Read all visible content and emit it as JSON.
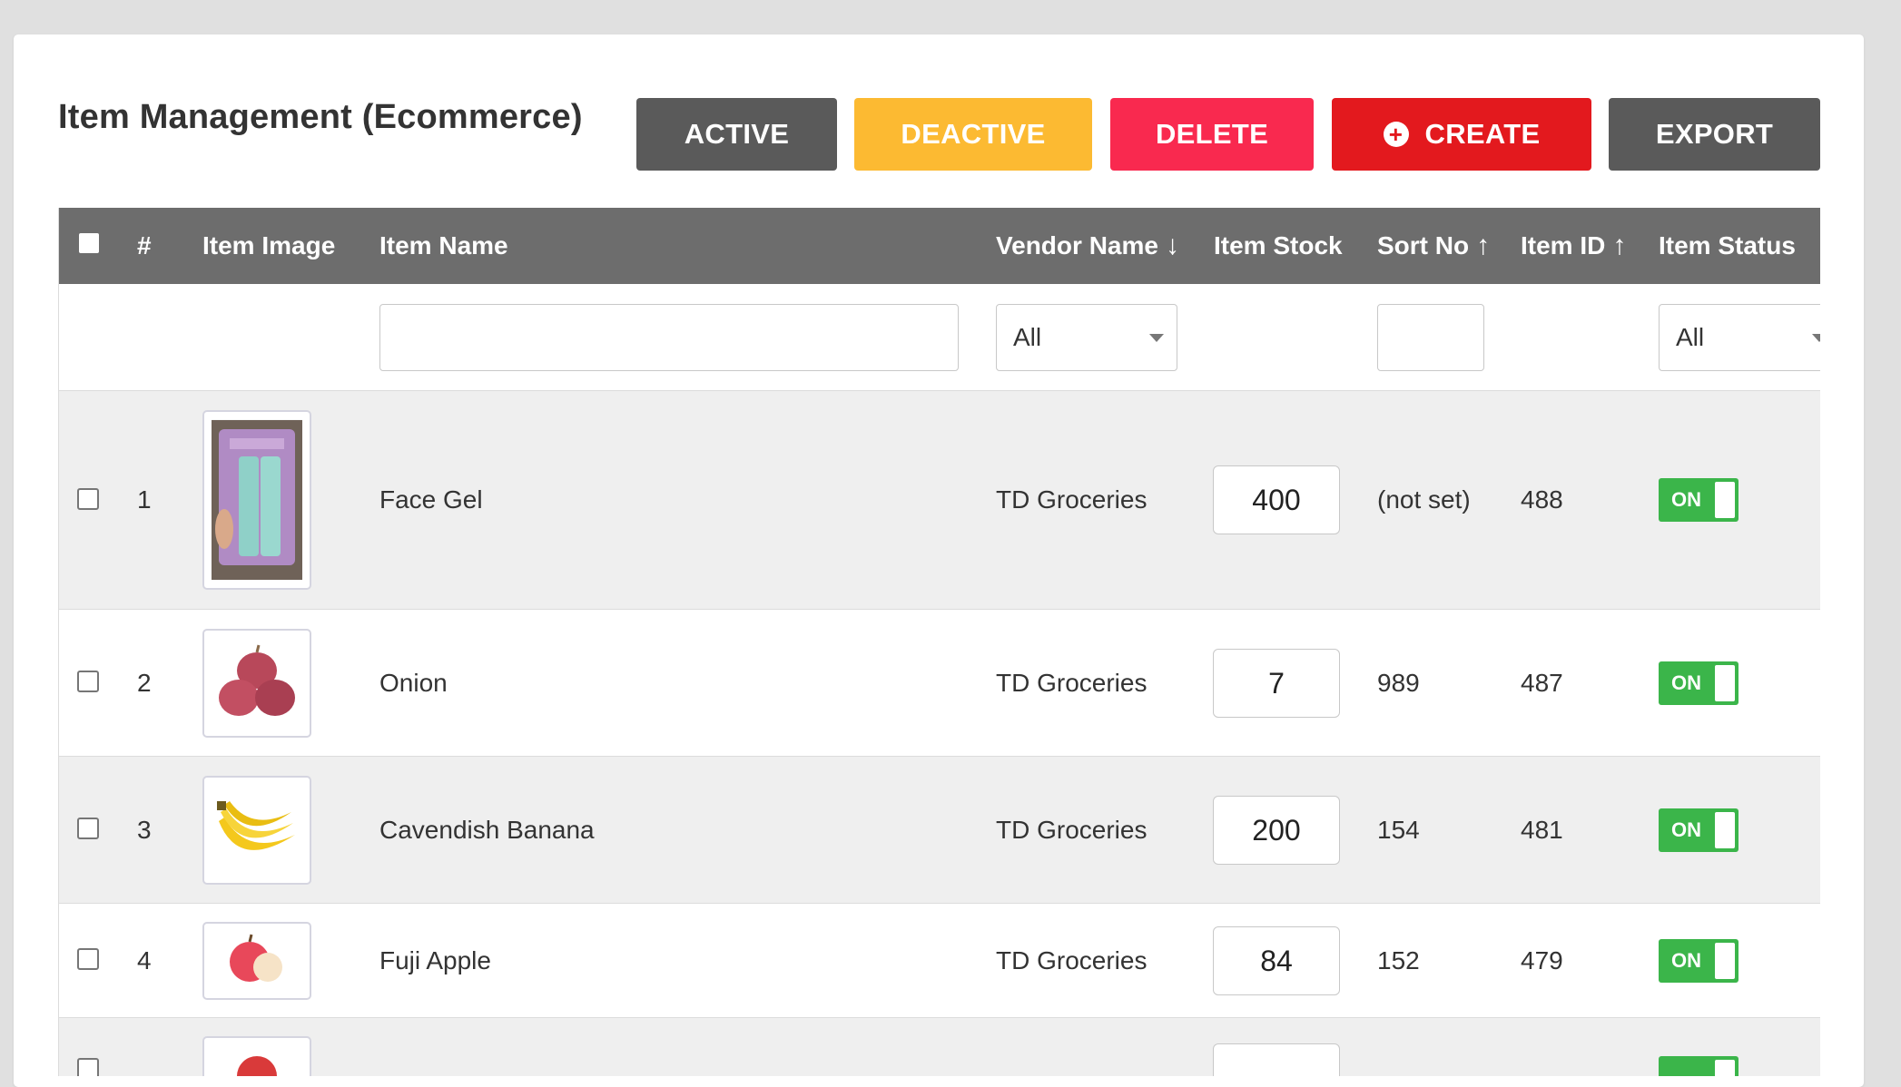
{
  "header": {
    "title": "Item Management (Ecommerce)",
    "buttons": {
      "active": "ACTIVE",
      "deactive": "DEACTIVE",
      "delete": "DELETE",
      "create": "CREATE",
      "export": "EXPORT"
    }
  },
  "colors": {
    "active_btn": "#5a5a5a",
    "deactive_btn": "#fcba32",
    "delete_btn": "#f9294f",
    "create_btn": "#e3191e",
    "export_btn": "#5a5a5a",
    "table_header": "#6d6d6d",
    "toggle_on": "#3bb54a"
  },
  "table": {
    "columns": {
      "num": "#",
      "image": "Item Image",
      "name": "Item Name",
      "vendor": "Vendor Name",
      "stock": "Item Stock",
      "sort": "Sort No",
      "id": "Item ID",
      "status": "Item Status"
    },
    "sort_icons": {
      "vendor": "arrow-down-icon",
      "sort": "arrow-up-icon",
      "id": "arrow-up-icon"
    },
    "filters": {
      "name_value": "",
      "vendor_selected": "All",
      "sort_value": "",
      "status_selected": "All"
    },
    "rows": [
      {
        "num": "1",
        "image_icon": "travel-bottles-image",
        "name": "Face Gel",
        "vendor": "TD Groceries",
        "stock": "400",
        "sort": "(not set)",
        "id": "488",
        "status": "ON"
      },
      {
        "num": "2",
        "image_icon": "onion-image",
        "name": "Onion",
        "vendor": "TD Groceries",
        "stock": "7",
        "sort": "989",
        "id": "487",
        "status": "ON"
      },
      {
        "num": "3",
        "image_icon": "banana-image",
        "name": "Cavendish Banana",
        "vendor": "TD Groceries",
        "stock": "200",
        "sort": "154",
        "id": "481",
        "status": "ON"
      },
      {
        "num": "4",
        "image_icon": "apple-image",
        "name": "Fuji Apple",
        "vendor": "TD Groceries",
        "stock": "84",
        "sort": "152",
        "id": "479",
        "status": "ON"
      }
    ]
  }
}
